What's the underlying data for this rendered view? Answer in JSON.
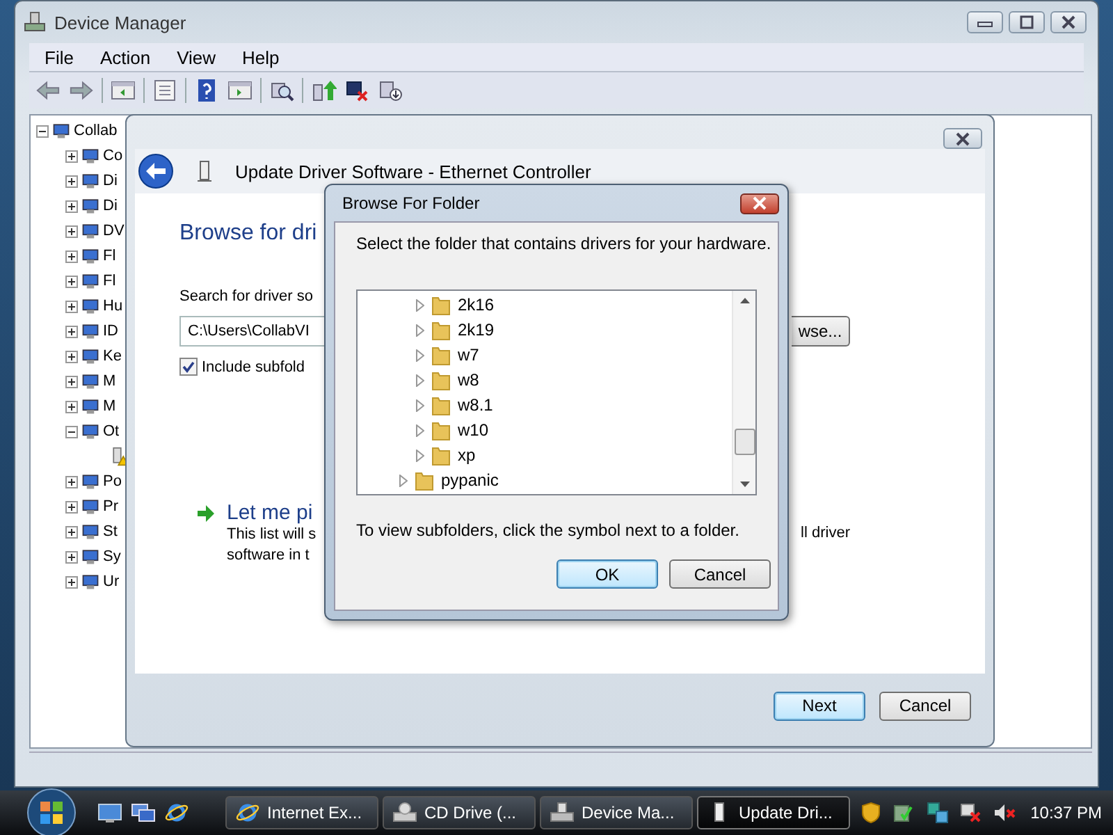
{
  "device_manager": {
    "title": "Device Manager",
    "menu": [
      "File",
      "Action",
      "View",
      "Help"
    ],
    "tree": {
      "label": "Collab",
      "expanded": true,
      "children": [
        {
          "label": "Co",
          "expanded": false
        },
        {
          "label": "Di",
          "expanded": false
        },
        {
          "label": "Di",
          "expanded": false
        },
        {
          "label": "DV",
          "expanded": false
        },
        {
          "label": "Fl",
          "expanded": false
        },
        {
          "label": "Fl",
          "expanded": false
        },
        {
          "label": "Hu",
          "expanded": false
        },
        {
          "label": "ID",
          "expanded": false
        },
        {
          "label": "Ke",
          "expanded": false
        },
        {
          "label": "M",
          "expanded": false
        },
        {
          "label": "M",
          "expanded": false
        },
        {
          "label": "Ot",
          "expanded": true,
          "children": [
            {
              "kind": "warning"
            }
          ]
        },
        {
          "label": "Po",
          "expanded": false
        },
        {
          "label": "Pr",
          "expanded": false
        },
        {
          "label": "St",
          "expanded": false
        },
        {
          "label": "Sy",
          "expanded": false
        },
        {
          "label": "Ur",
          "expanded": false
        }
      ]
    }
  },
  "wizard": {
    "title": "Update Driver Software - Ethernet Controller",
    "heading": "Browse for dri",
    "search_label": "Search for driver so",
    "path_value": "C:\\Users\\CollabVI",
    "browse_button": "wse...",
    "include_subfolders": {
      "label": "Include subfold",
      "checked": true
    },
    "link": "Let me pi",
    "description_lines": [
      "This list will s",
      "software in t"
    ],
    "description_right": "ll driver",
    "buttons": [
      {
        "label": "Next",
        "default": true
      },
      {
        "label": "Cancel",
        "default": false
      }
    ]
  },
  "dialog": {
    "title": "Browse For Folder",
    "prompt": "Select the folder that contains drivers for your hardware.",
    "folders": [
      {
        "children": [
          {
            "label": "2k16"
          },
          {
            "label": "2k19"
          },
          {
            "label": "w7"
          },
          {
            "label": "w8"
          },
          {
            "label": "w8.1"
          },
          {
            "label": "w10"
          },
          {
            "label": "xp"
          }
        ]
      },
      {
        "label": "pypanic"
      }
    ],
    "hint": "To view subfolders, click the symbol next to a folder.",
    "buttons": [
      {
        "label": "OK",
        "default": true
      },
      {
        "label": "Cancel",
        "default": false
      }
    ]
  },
  "taskbar": {
    "items": [
      {
        "label": "Internet Ex...",
        "kind": "browser",
        "selected": false
      },
      {
        "label": "CD Drive (...",
        "kind": "drive",
        "selected": false
      },
      {
        "label": "Device Ma...",
        "kind": "device-manager",
        "selected": false
      },
      {
        "label": "Update Dri...",
        "kind": "driver",
        "selected": true
      }
    ],
    "clock": "10:37 PM"
  }
}
